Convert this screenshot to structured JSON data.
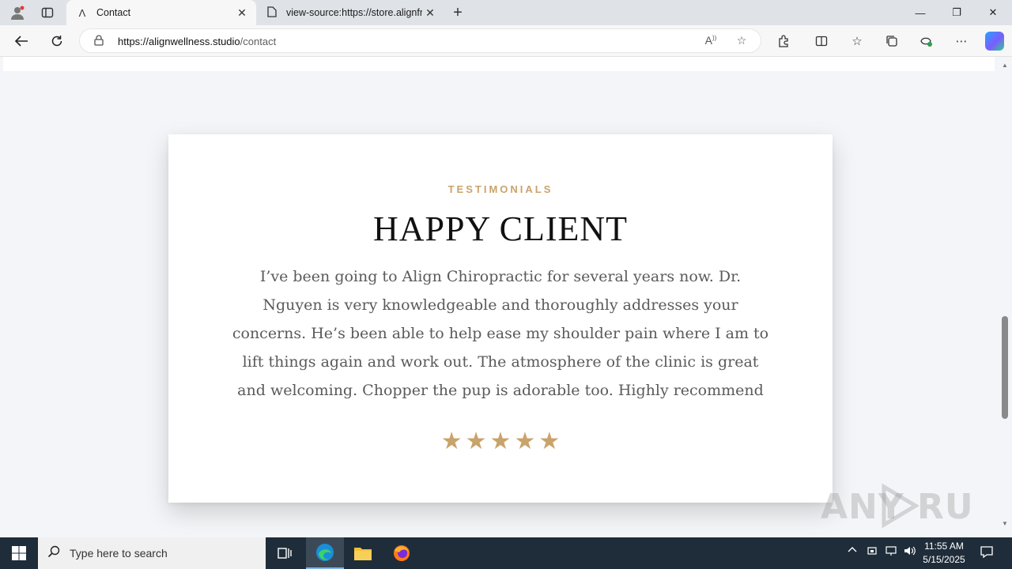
{
  "browser": {
    "tabs": [
      {
        "title": "Contact",
        "icon": "align-logo-icon"
      },
      {
        "title": "view-source:https://store.alignfri",
        "icon": "page-icon"
      }
    ],
    "url_host": "https://alignwellness.studio",
    "url_path": "/contact"
  },
  "page": {
    "eyebrow": "TESTIMONIALS",
    "heading": "HAPPY CLIENT",
    "quote": "I’ve been going to Align Chiropractic for several years now. Dr. Nguyen is very knowledgeable and thoroughly addresses your concerns. He’s been able to help ease my shoulder pain where I am to lift things again and work out. The atmosphere of the clinic is great and welcoming. Chopper the pup is adorable too. Highly recommend",
    "rating": 5,
    "star_color": "#c9a36a"
  },
  "watermark": "ANY RUN",
  "taskbar": {
    "search_placeholder": "Type here to search",
    "time": "11:55 AM",
    "date": "5/15/2025"
  }
}
